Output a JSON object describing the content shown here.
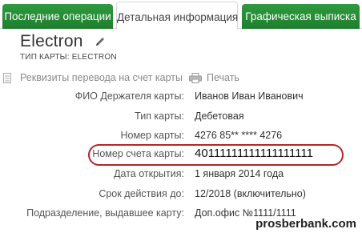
{
  "tabs": [
    {
      "label": "Последние операции",
      "active": false
    },
    {
      "label": "Детальная информация",
      "active": true
    },
    {
      "label": "Графическая выписка",
      "active": false
    }
  ],
  "card": {
    "title": "Electron",
    "type_label": "ТИП КАРТЫ: ELECTRON"
  },
  "actions": {
    "requisites": "Реквизиты перевода на счет карты",
    "print": "Печать"
  },
  "details": [
    {
      "label": "ФИО Держателя карты:",
      "value": "Иванов Иван Иванович"
    },
    {
      "label": "Тип карты:",
      "value": "Дебетовая"
    },
    {
      "label": "Номер карты:",
      "value": "4276 85** **** 4276"
    },
    {
      "label": "Номер счета карты:",
      "value": "40111111111111111111"
    },
    {
      "label": "Дата открытия:",
      "value": "1 января 2014 года"
    },
    {
      "label": "Срок действия до:",
      "value": "12/2018 (включительно)"
    },
    {
      "label": "Подразделение, выдавшее карту:",
      "value": "Доп.офис №1111/1111"
    }
  ],
  "watermark": "prosberbank.com",
  "colors": {
    "tab_green": "#1f7e2e",
    "highlight": "#b5262d"
  }
}
